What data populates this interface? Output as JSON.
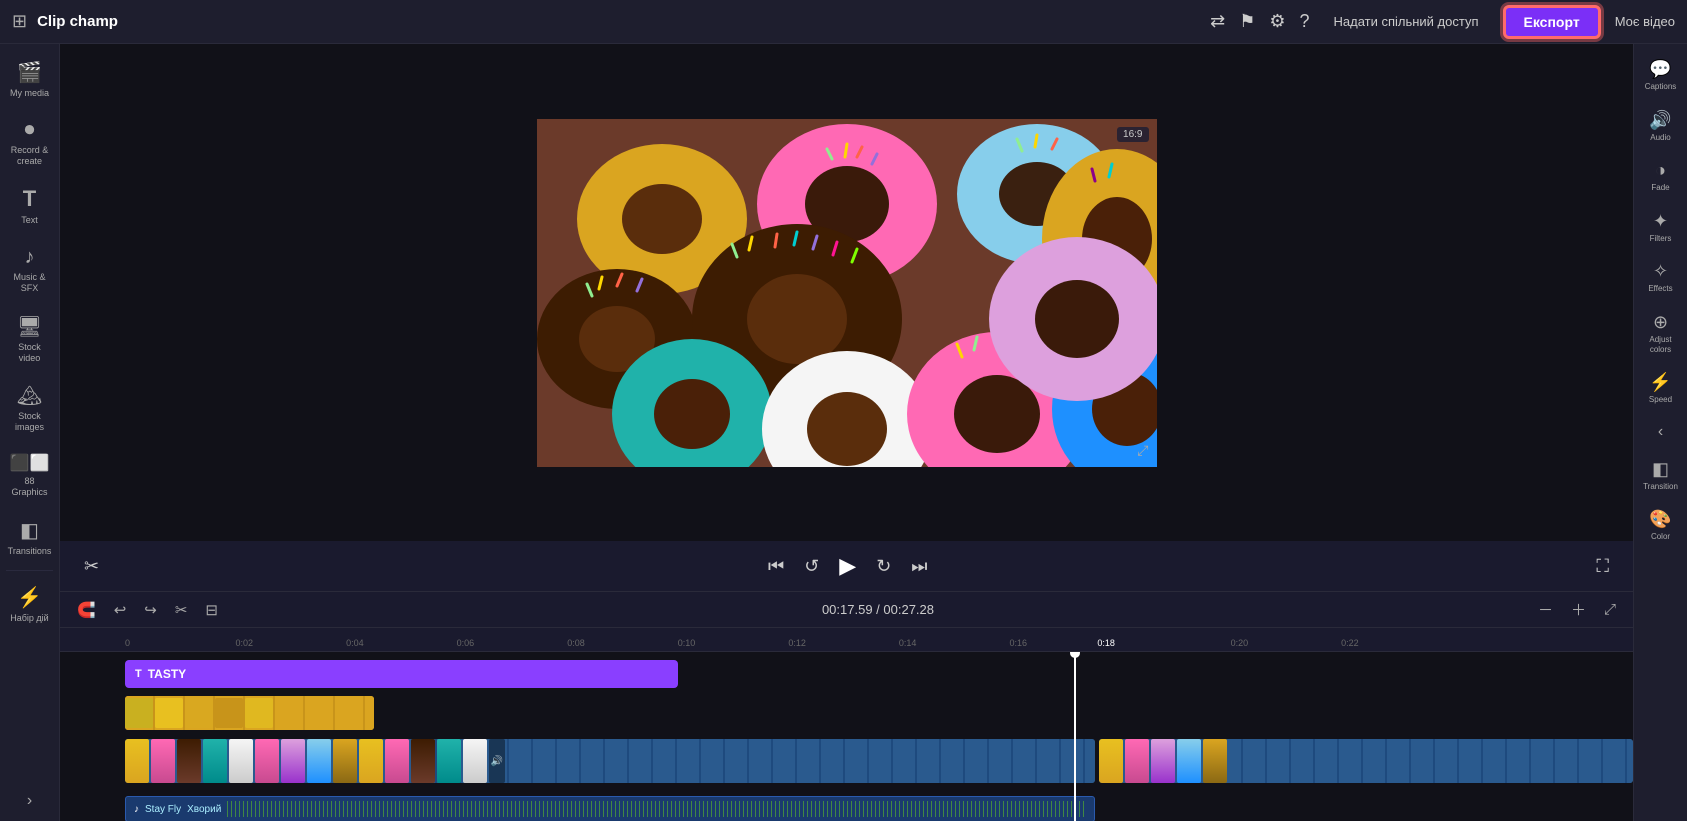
{
  "app": {
    "title": "Clip champ",
    "ratio": "16:9"
  },
  "topbar": {
    "share_label": "Надати спільний доступ",
    "export_label": "Експорт",
    "my_video_label": "Моє відео"
  },
  "sidebar_left": {
    "items": [
      {
        "id": "my-media",
        "icon": "🎬",
        "label": "My media"
      },
      {
        "id": "record-create",
        "icon": "🔴",
        "label": "Record & create"
      },
      {
        "id": "text",
        "icon": "T",
        "label": "Text"
      },
      {
        "id": "music-sfx",
        "icon": "♪",
        "label": "Music & SFX"
      },
      {
        "id": "stock-video",
        "icon": "📹",
        "label": "Stock video"
      },
      {
        "id": "stock-images",
        "icon": "🖼",
        "label": "Stock images"
      },
      {
        "id": "graphics",
        "icon": "⬛",
        "label": "88 Graphics"
      },
      {
        "id": "transitions",
        "icon": "◧",
        "label": "Transitions"
      },
      {
        "id": "набір-дій",
        "icon": "⚡",
        "label": "Набір дій"
      }
    ]
  },
  "sidebar_right": {
    "items": [
      {
        "id": "captions",
        "icon": "💬",
        "label": "Captions"
      },
      {
        "id": "audio",
        "icon": "🔊",
        "label": "Audio"
      },
      {
        "id": "fade",
        "icon": "◑",
        "label": "Fade"
      },
      {
        "id": "filters",
        "icon": "✦",
        "label": "Filters"
      },
      {
        "id": "effects",
        "icon": "✧",
        "label": "Effects"
      },
      {
        "id": "adjust-colors",
        "icon": "⊕",
        "label": "Adjust colors"
      },
      {
        "id": "speed",
        "icon": "⚡",
        "label": "Speed"
      },
      {
        "id": "transition",
        "icon": "◧",
        "label": "Transition"
      },
      {
        "id": "color",
        "icon": "🎨",
        "label": "Color"
      }
    ]
  },
  "preview": {
    "time_current": "00:17.59",
    "time_total": "00:27.28",
    "ratio": "16:9"
  },
  "timeline": {
    "time_display": "00:17.59 / 00:27.28",
    "ruler_marks": [
      "0",
      "0:02",
      "0:04",
      "0:06",
      "0:08",
      "0:10",
      "0:12",
      "0:14",
      "0:16",
      "0:18",
      "0:20",
      "0:22"
    ],
    "text_clip_label": "TASTY",
    "audio_track_name": "Stay Fly",
    "audio_track_label": "Хворий"
  }
}
